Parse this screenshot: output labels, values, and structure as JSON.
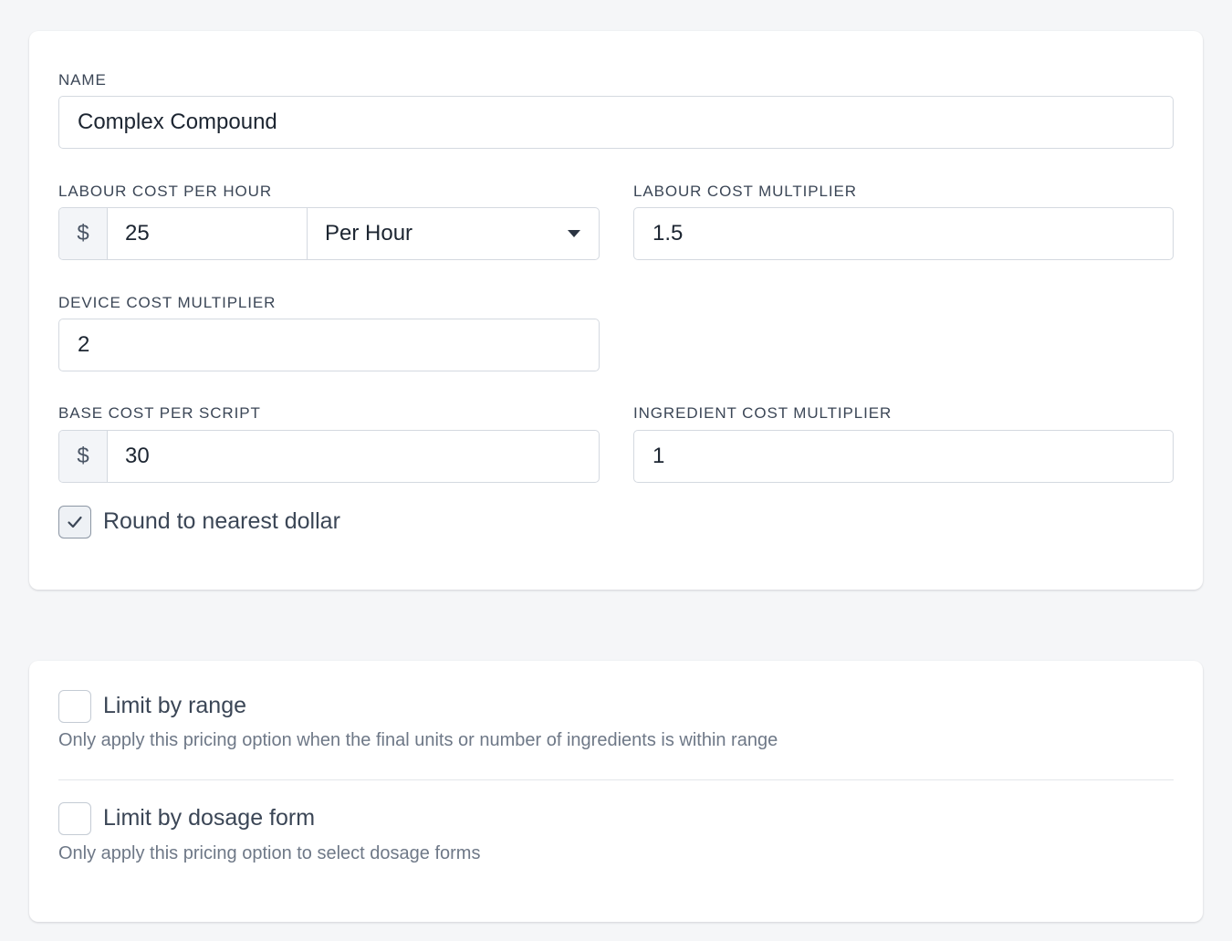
{
  "pricing_form": {
    "name": {
      "label": "NAME",
      "value": "Complex Compound"
    },
    "labour_cost_per_hour": {
      "label": "LABOUR COST PER HOUR",
      "currency_symbol": "$",
      "value": "25",
      "unit_selected": "Per Hour"
    },
    "labour_cost_multiplier": {
      "label": "LABOUR COST MULTIPLIER",
      "value": "1.5"
    },
    "device_cost_multiplier": {
      "label": "DEVICE COST MULTIPLIER",
      "value": "2"
    },
    "base_cost_per_script": {
      "label": "BASE COST PER SCRIPT",
      "currency_symbol": "$",
      "value": "30"
    },
    "ingredient_cost_multiplier": {
      "label": "INGREDIENT COST MULTIPLIER",
      "value": "1"
    },
    "round_to_nearest_dollar": {
      "label": "Round to nearest dollar",
      "checked": true
    }
  },
  "limits": {
    "limit_by_range": {
      "label": "Limit by range",
      "help": "Only apply this pricing option when the final units or number of ingredients is within range",
      "checked": false
    },
    "limit_by_dosage_form": {
      "label": "Limit by dosage form",
      "help": "Only apply this pricing option to select dosage forms",
      "checked": false
    }
  },
  "icons": {
    "checkmark": "check-icon",
    "dropdown": "caret-down-icon"
  }
}
